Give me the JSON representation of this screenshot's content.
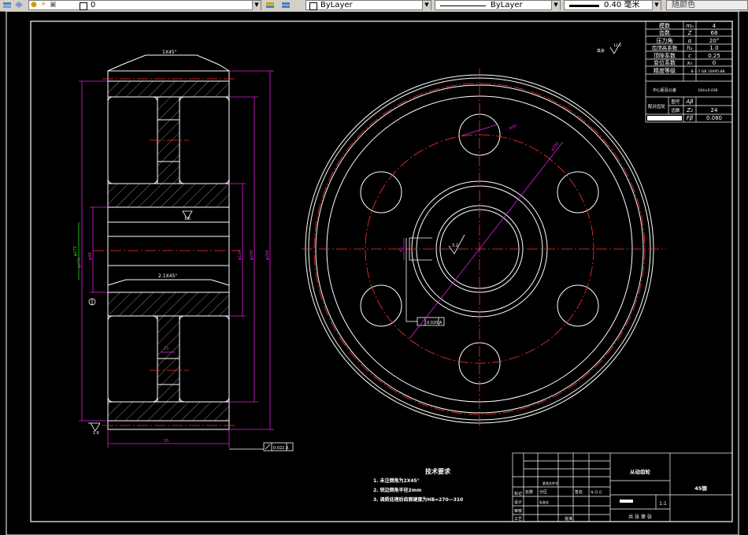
{
  "toolbar": {
    "layer_value": "0",
    "color_value": "ByLayer",
    "linetype_value": "ByLayer",
    "lineweight_value": "0.40 毫米",
    "plotstyle_value": "随颜色"
  },
  "params_table": {
    "rows": [
      {
        "label": "模数",
        "symbol": "mₙ",
        "value": "4"
      },
      {
        "label": "齿数",
        "symbol": "Z",
        "value": "68"
      },
      {
        "label": "压力角",
        "symbol": "α",
        "value": "20°"
      },
      {
        "label": "齿顶高系数",
        "symbol": "hₐ",
        "value": "1.0"
      },
      {
        "label": "顶隙系数",
        "symbol": "c",
        "value": "0.25"
      },
      {
        "label": "变位系数",
        "symbol": "xₙ",
        "value": "0"
      },
      {
        "label": "精度等级",
        "symbol": "",
        "value": "8-7-7 GB 10095-88"
      },
      {
        "label": "中心距及公差",
        "symbol": "",
        "value": "164±0.036"
      }
    ],
    "group_label": "配对齿轮",
    "group_rows": [
      {
        "label": "图号",
        "symbol": "Aβ",
        "value": ""
      },
      {
        "label": "齿数",
        "symbol": "Z₂",
        "value": "24"
      }
    ],
    "last_row": {
      "symbol": "Fβ",
      "value": "0.080"
    }
  },
  "tech_req": {
    "title": "技术要求",
    "items": [
      "1.  未注倒角为2X45°",
      "2.  锐边倒角半径2mm",
      "3.  调质处理后齿面硬度为HB=270—310"
    ]
  },
  "title_block": {
    "part_name": "从动齿轮",
    "material": "45钢",
    "scale": "1:1",
    "drawing_no": "共 张 第 张",
    "row_labels": [
      "标记",
      "设计",
      "审核",
      "工艺"
    ],
    "header_small": [
      "处数",
      "分区",
      "更改文件号",
      "签名",
      "年.月.日"
    ],
    "header_small2": [
      "标准化",
      "批准"
    ],
    "approve": "批准"
  },
  "annotations": {
    "chamfer_top": "1X45°",
    "chamfer_mid": "2.1X45°",
    "roughness_left_mid": "1.6",
    "roughness_left_bottom": "1.6",
    "roughness_center": "3.2",
    "roughness_corner_label": "其余",
    "roughness_corner": "12.5",
    "tol_frame_left": "0.022 A",
    "tol_frame_right": "0.020 A",
    "dim_bottom": "55",
    "dim_hole": "φ20",
    "dim_vertical_green": "φ272",
    "dim_pcd": "φ200",
    "dim_keyway": "45",
    "dim_left_outer": "φ278",
    "dim_right_outer": "φ260",
    "dim_right_mid": "φ200",
    "dim_right_inner": "φ124",
    "dim_left_inner": "φ48",
    "dim_hub_width": "15",
    "dim_hub_width2": "15",
    "datum_label": "A"
  }
}
